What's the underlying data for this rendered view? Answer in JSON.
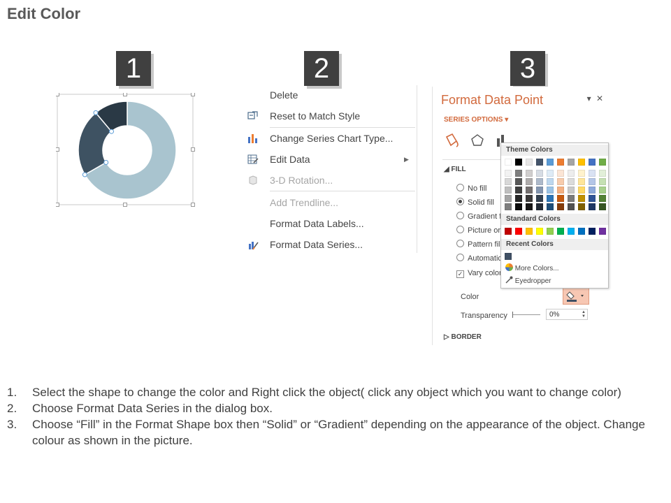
{
  "page": {
    "title": "Edit Color"
  },
  "steps": [
    "1",
    "2",
    "3"
  ],
  "context_menu": {
    "items": [
      {
        "label": "Delete",
        "disabled": false,
        "icon": ""
      },
      {
        "label": "Reset to Match Style",
        "disabled": false,
        "icon": "reset-style-icon"
      },
      {
        "label": "Change Series Chart Type...",
        "disabled": false,
        "icon": "bar-chart-icon"
      },
      {
        "label": "Edit Data",
        "disabled": false,
        "icon": "edit-data-icon",
        "submenu": true
      },
      {
        "label": "3-D Rotation...",
        "disabled": true,
        "icon": "cube-icon"
      },
      {
        "label": "Add Trendline...",
        "disabled": true,
        "icon": ""
      },
      {
        "label": "Format Data Labels...",
        "disabled": false,
        "icon": ""
      },
      {
        "label": "Format Data Series...",
        "disabled": false,
        "icon": "format-series-icon"
      }
    ]
  },
  "format_pane": {
    "title": "Format Data Point",
    "series_options": "SERIES OPTIONS",
    "fill_header": "FILL",
    "fill_options": [
      {
        "label": "No fill",
        "selected": false
      },
      {
        "label": "Solid fill",
        "selected": true
      },
      {
        "label": "Gradient fi",
        "selected": false
      },
      {
        "label": "Picture or",
        "selected": false
      },
      {
        "label": "Pattern fill",
        "selected": false
      },
      {
        "label": "Automatic",
        "selected": false
      }
    ],
    "vary_colors": "Vary color",
    "color_label": "Color",
    "transparency_label": "Transparency",
    "transparency_value": "0%",
    "border_header": "BORDER",
    "accent_color": "#d26a3d"
  },
  "color_popup": {
    "theme_header": "Theme Colors",
    "standard_header": "Standard Colors",
    "recent_header": "Recent Colors",
    "more_colors": "More Colors...",
    "eyedropper": "Eyedropper",
    "theme_base": [
      "#ffffff",
      "#000000",
      "#e7e6e6",
      "#44546a",
      "#5b9bd5",
      "#ed7d31",
      "#a5a5a5",
      "#ffc000",
      "#4472c4",
      "#70ad47"
    ],
    "theme_shades": [
      [
        "#f2f2f2",
        "#7f7f7f",
        "#d0cece",
        "#d6dce4",
        "#deebf6",
        "#fbe5d5",
        "#ededed",
        "#fff2cc",
        "#d9e2f3",
        "#e2efd9"
      ],
      [
        "#d8d8d8",
        "#595959",
        "#aeabab",
        "#adb9ca",
        "#bdd7ee",
        "#f7cbac",
        "#dbdbdb",
        "#fee599",
        "#b4c6e7",
        "#c5e0b3"
      ],
      [
        "#bfbfbf",
        "#3f3f3f",
        "#757070",
        "#8496b0",
        "#9cc3e5",
        "#f4b183",
        "#c9c9c9",
        "#ffd965",
        "#8eaadb",
        "#a8d08d"
      ],
      [
        "#a5a5a5",
        "#262626",
        "#3a3838",
        "#323f4f",
        "#2e75b5",
        "#c55a11",
        "#7b7b7b",
        "#bf9000",
        "#2f5496",
        "#538135"
      ],
      [
        "#7f7f7f",
        "#0c0c0c",
        "#171616",
        "#222a35",
        "#1e4e79",
        "#843c0b",
        "#525252",
        "#7f6000",
        "#1f3864",
        "#375623"
      ]
    ],
    "standard": [
      "#c00000",
      "#ff0000",
      "#ffc000",
      "#ffff00",
      "#92d050",
      "#00b050",
      "#00b0f0",
      "#0070c0",
      "#002060",
      "#7030a0"
    ],
    "recent": [
      "#3f5064"
    ]
  },
  "donut": {
    "slice_colors": [
      "#a9c4cf",
      "#3e5262",
      "#2a3945"
    ],
    "selection_color": "#5b9bd5"
  },
  "instructions": [
    {
      "num": "1.",
      "text": "Select the shape to change the color and Right click the object( click any object which you want to change color)"
    },
    {
      "num": "2.",
      "text": "Choose Format Data Series in the dialog box."
    },
    {
      "num": "3.",
      "text": "Choose “Fill” in the Format Shape box then “Solid” or “Gradient” depending on the appearance of the object. Change colour as shown in the picture."
    }
  ]
}
